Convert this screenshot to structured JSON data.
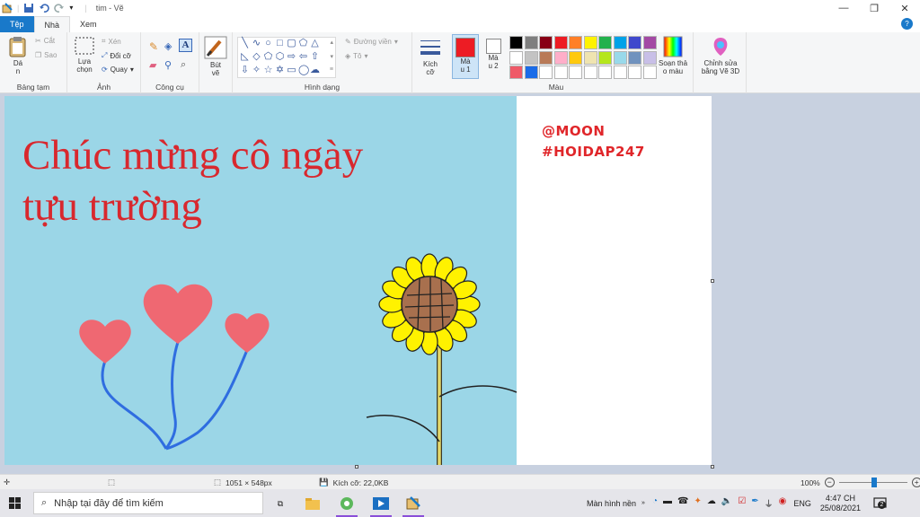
{
  "titlebar": {
    "title": "tim - Vẽ"
  },
  "tabs": {
    "file": "Tệp",
    "home": "Nhà",
    "view": "Xem"
  },
  "ribbon": {
    "clipboard": {
      "paste": "Dá",
      "paste_sub": "n",
      "cut": "Cắt",
      "copy": "Sao",
      "label": "Bảng tạm"
    },
    "image": {
      "select": "Lựa",
      "select_sub": "chọn",
      "crop": "Xén",
      "resize": "Đổi cỡ",
      "rotate": "Quay",
      "label": "Ảnh"
    },
    "tools": {
      "label": "Công cụ"
    },
    "brushes": {
      "label": "Bút",
      "label_sub": "vẽ"
    },
    "shapes": {
      "outline": "Đường viền",
      "fill": "Tô",
      "label": "Hình dạng"
    },
    "size": {
      "label": "Kích",
      "label_sub": "cỡ"
    },
    "colors": {
      "color1": "Mà",
      "color1_sub": "u 1",
      "color1_value": "#ed1c24",
      "color2": "Mà",
      "color2_sub": "u 2",
      "color2_value": "#ffffff",
      "edit": "Soạn thả",
      "edit_sub": "o màu",
      "paint3d": "Chỉnh sửa",
      "paint3d_sub": "bằng Vẽ 3D",
      "label": "Màu",
      "palette_row1": [
        "#000000",
        "#7f7f7f",
        "#880015",
        "#ed1c24",
        "#ff7f27",
        "#fff200",
        "#22b14c",
        "#00a2e8",
        "#3f48cc",
        "#a349a4"
      ],
      "palette_row2": [
        "#ffffff",
        "#c3c3c3",
        "#b97a57",
        "#ffaec9",
        "#ffc90e",
        "#efe4b0",
        "#b5e61d",
        "#99d9ea",
        "#7092be",
        "#c8bfe7"
      ],
      "palette_row3": [
        "#ef5a68",
        "#1a6ce8",
        "#ffffff",
        "#ffffff",
        "#ffffff",
        "#ffffff",
        "#ffffff",
        "#ffffff",
        "#ffffff",
        "#ffffff"
      ]
    }
  },
  "canvas": {
    "greeting": "Chúc mừng cô ngày\ntựu trường",
    "tag1": "@MOON",
    "tag2": "#HOIDAP247",
    "sky_color": "#9bd6e7"
  },
  "status": {
    "dimensions": "1051 × 548px",
    "size": "Kích cỡ: 22,0KB",
    "zoom": "100%"
  },
  "taskbar": {
    "search_placeholder": "Nhập tại đây để tìm kiếm",
    "desktop_label": "Màn hình nền",
    "lang": "ENG",
    "time": "4:47 CH",
    "date": "25/08/2021",
    "notifications": "2"
  }
}
